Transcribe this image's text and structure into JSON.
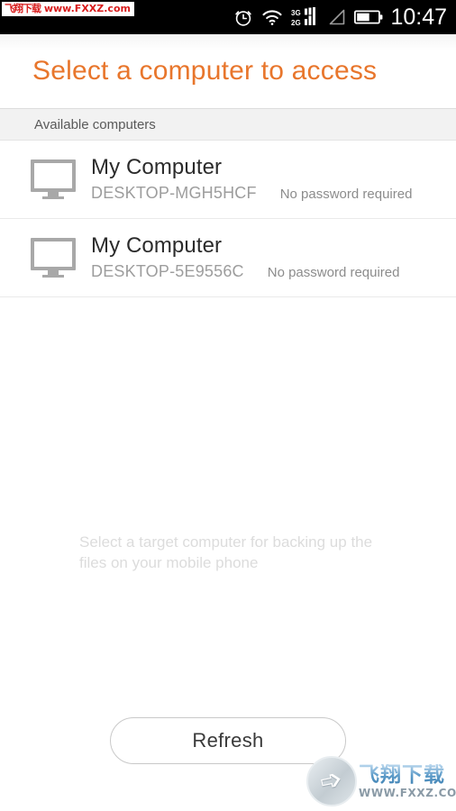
{
  "status_bar": {
    "time": "10:47",
    "icons": [
      "alarm-clock-icon",
      "wifi-icon",
      "cellular-signal-icon",
      "signal-triangle-icon",
      "battery-icon"
    ],
    "signal_labels": [
      "3G",
      "2G"
    ],
    "background_color": "#000000"
  },
  "watermark_top": {
    "chinese": "飞翔下载",
    "url": "www.FXXZ.com",
    "color": "#d81c1c"
  },
  "header": {
    "title": "Select a computer to access",
    "title_color": "#e8762c"
  },
  "section": {
    "label": "Available computers"
  },
  "computers": [
    {
      "name": "My Computer",
      "hostname": "DESKTOP-MGH5HCF",
      "status": "No password required",
      "icon": "monitor-icon"
    },
    {
      "name": "My Computer",
      "hostname": "DESKTOP-5E9556C",
      "status": "No password required",
      "icon": "monitor-icon"
    }
  ],
  "hint": {
    "text": "Select a target computer for backing up the files on your mobile phone",
    "color": "#dcdcdc"
  },
  "refresh": {
    "label": "Refresh"
  },
  "watermark_bottom": {
    "chinese": "飞翔下载",
    "url": "WWW.FXXZ.COM",
    "logo": "swirl-bird-logo"
  }
}
